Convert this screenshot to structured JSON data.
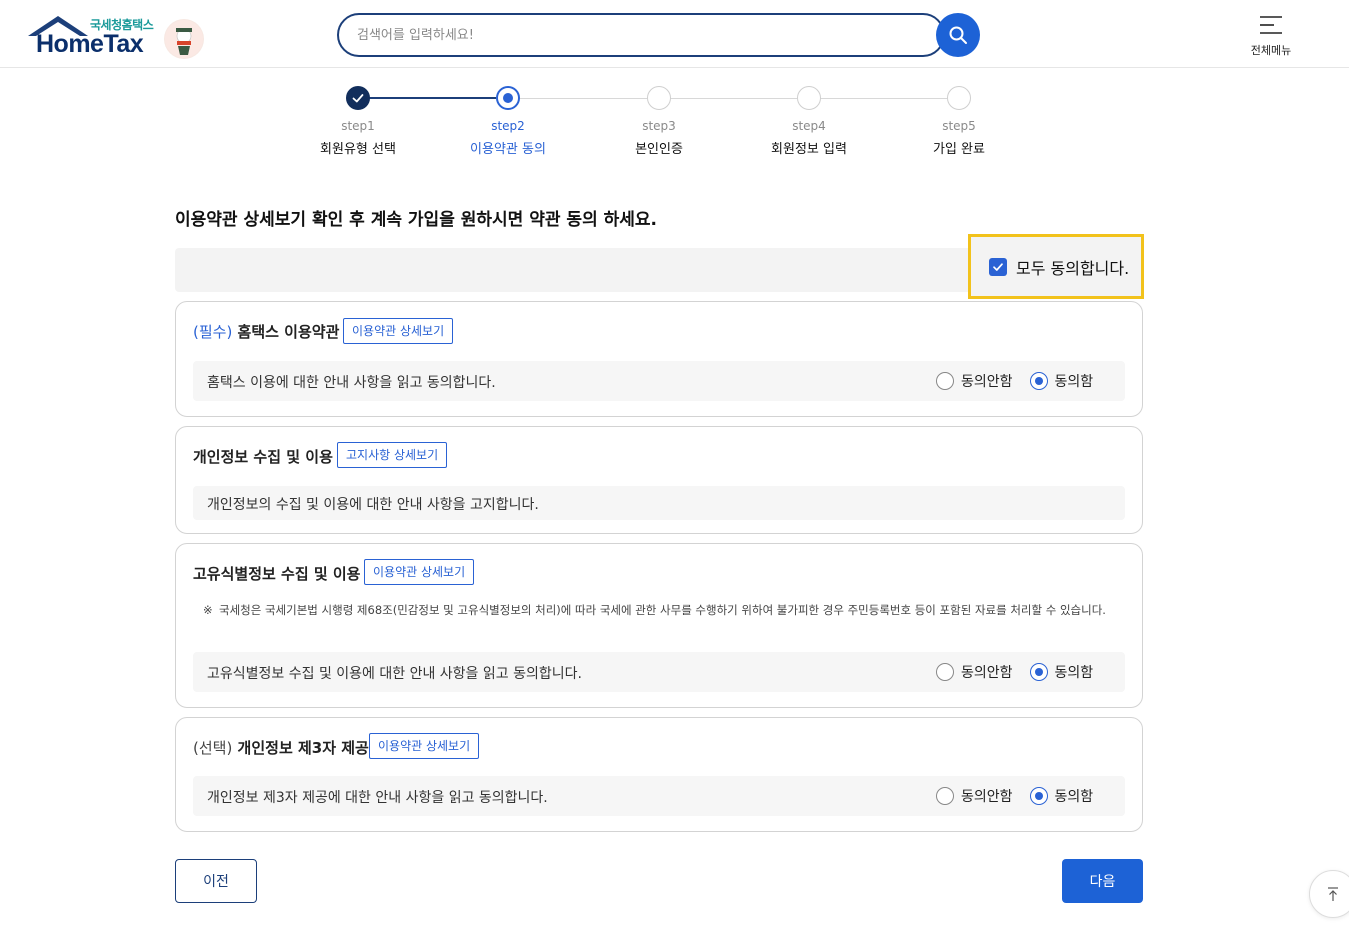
{
  "header": {
    "logo_ko": "국세청홈택스",
    "logo_en": "HomeTax",
    "search_placeholder": "검색어를 입력하세요!",
    "all_menu_label": "전체메뉴",
    "brand_color": "#1d62d6"
  },
  "steps": [
    {
      "num": "step1",
      "label": "회원유형 선택",
      "state": "done"
    },
    {
      "num": "step2",
      "label": "이용약관 동의",
      "state": "current"
    },
    {
      "num": "step3",
      "label": "본인인증",
      "state": "todo"
    },
    {
      "num": "step4",
      "label": "회원정보 입력",
      "state": "todo"
    },
    {
      "num": "step5",
      "label": "가입 완료",
      "state": "todo"
    }
  ],
  "intro": "이용약관 상세보기 확인 후 계속 가입을 원하시면 약관 동의 하세요.",
  "agree_all": {
    "label": "모두 동의합니다.",
    "checked": true
  },
  "sections": [
    {
      "prefix": "(필수)",
      "title": "홈택스 이용약관",
      "detail_button": "이용약관 상세보기",
      "text": "홈택스 이용에 대한 안내 사항을 읽고 동의합니다.",
      "disagree": "동의안함",
      "agree": "동의함",
      "selected": "agree"
    },
    {
      "title": "개인정보 수집 및 이용",
      "detail_button": "고지사항 상세보기",
      "text": "개인정보의 수집 및 이용에 대한 안내 사항을 고지합니다."
    },
    {
      "title": "고유식별정보 수집 및 이용",
      "detail_button": "이용약관 상세보기",
      "note_mark": "※",
      "note": "국세청은 국세기본법 시행령 제68조(민감정보 및 고유식별정보의 처리)에 따라 국세에 관한 사무를 수행하기 위하여 불가피한 경우 주민등록번호 등이 포함된 자료를 처리할 수 있습니다.",
      "text": "고유식별정보 수집 및 이용에 대한 안내 사항을 읽고 동의합니다.",
      "disagree": "동의안함",
      "agree": "동의함",
      "selected": "agree"
    },
    {
      "prefix": "(선택)",
      "title": "개인정보 제3자 제공",
      "detail_button": "이용약관 상세보기",
      "text": "개인정보 제3자 제공에 대한 안내 사항을 읽고 동의합니다.",
      "disagree": "동의안함",
      "agree": "동의함",
      "selected": "agree"
    }
  ],
  "buttons": {
    "prev": "이전",
    "next": "다음"
  }
}
